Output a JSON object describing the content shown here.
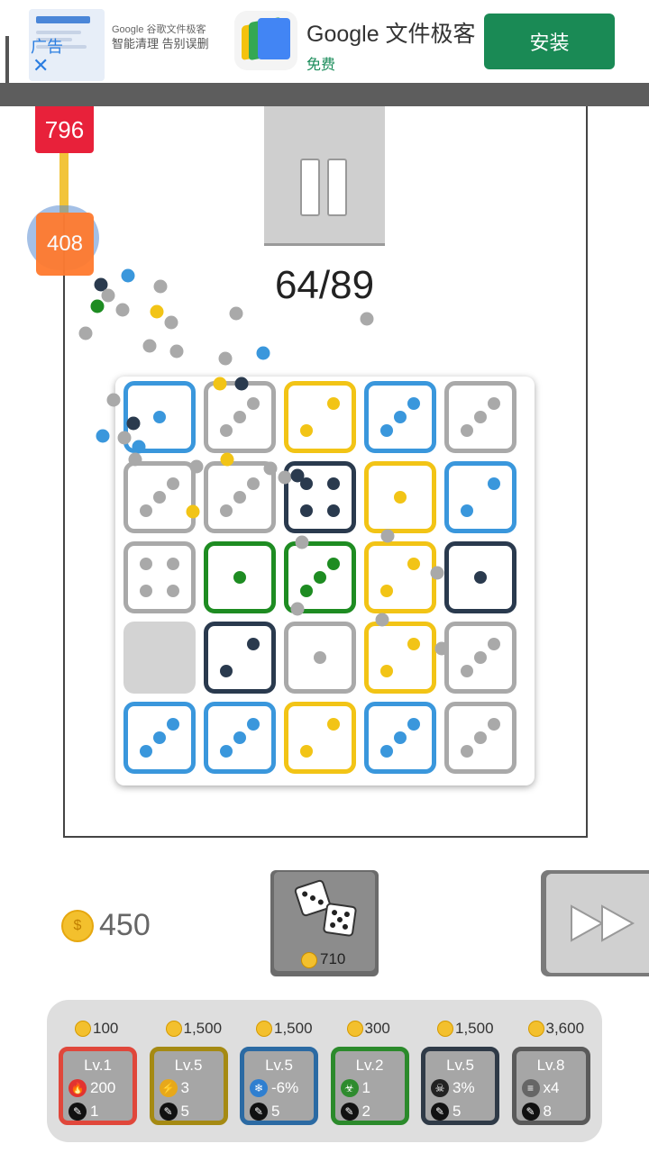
{
  "ad": {
    "label": "广告",
    "close": "✕",
    "small_line1": "Google 谷歌文件极客",
    "small_line2": "智能清理  告别误删",
    "title": "Google 文件极客",
    "subtitle": "免费",
    "install": "安装"
  },
  "game": {
    "wave": "64/89",
    "enemies": [
      "796",
      "408"
    ],
    "coins": "450",
    "roll_cost": "710"
  },
  "colors": {
    "blue": "#3a97dc",
    "gray": "#a9a9a9",
    "yellow": "#f2c416",
    "navy": "#2a3a4e",
    "green": "#1e8c22"
  },
  "board": [
    [
      {
        "c": "blue",
        "n": 1
      },
      {
        "c": "gray",
        "n": 3
      },
      {
        "c": "yellow",
        "n": 2
      },
      {
        "c": "blue",
        "n": 3
      },
      {
        "c": "gray",
        "n": 3
      }
    ],
    [
      {
        "c": "gray",
        "n": 3
      },
      {
        "c": "gray",
        "n": 3
      },
      {
        "c": "navy",
        "n": 4
      },
      {
        "c": "yellow",
        "n": 1
      },
      {
        "c": "blue",
        "n": 2
      }
    ],
    [
      {
        "c": "gray",
        "n": 4
      },
      {
        "c": "green",
        "n": 1
      },
      {
        "c": "green",
        "n": 3
      },
      {
        "c": "yellow",
        "n": 2
      },
      {
        "c": "navy",
        "n": 1
      }
    ],
    [
      {
        "c": "empty",
        "n": 0
      },
      {
        "c": "navy",
        "n": 2
      },
      {
        "c": "gray",
        "n": 1
      },
      {
        "c": "yellow",
        "n": 2
      },
      {
        "c": "gray",
        "n": 3
      }
    ],
    [
      {
        "c": "blue",
        "n": 3
      },
      {
        "c": "blue",
        "n": 3
      },
      {
        "c": "yellow",
        "n": 2
      },
      {
        "c": "blue",
        "n": 3
      },
      {
        "c": "gray",
        "n": 3
      }
    ]
  ],
  "shop": [
    {
      "price": "100",
      "level": "Lv.1",
      "stat": "200",
      "dmg": "1",
      "icon": "fire-icon",
      "border": "#e0473b"
    },
    {
      "price": "1,500",
      "level": "Lv.5",
      "stat": "3",
      "dmg": "5",
      "icon": "lightning-icon",
      "border": "#a58a13"
    },
    {
      "price": "1,500",
      "level": "Lv.5",
      "stat": "-6%",
      "dmg": "5",
      "icon": "snowflake-icon",
      "border": "#2b6aa3"
    },
    {
      "price": "300",
      "level": "Lv.2",
      "stat": "1",
      "dmg": "2",
      "icon": "poison-icon",
      "border": "#2b8a2b"
    },
    {
      "price": "1,500",
      "level": "Lv.5",
      "stat": "3%",
      "dmg": "5",
      "icon": "skull-icon",
      "border": "#2f3a47"
    },
    {
      "price": "3,600",
      "level": "Lv.8",
      "stat": "x4",
      "dmg": "8",
      "icon": "bullet-icon",
      "border": "#5a5a5a"
    }
  ]
}
